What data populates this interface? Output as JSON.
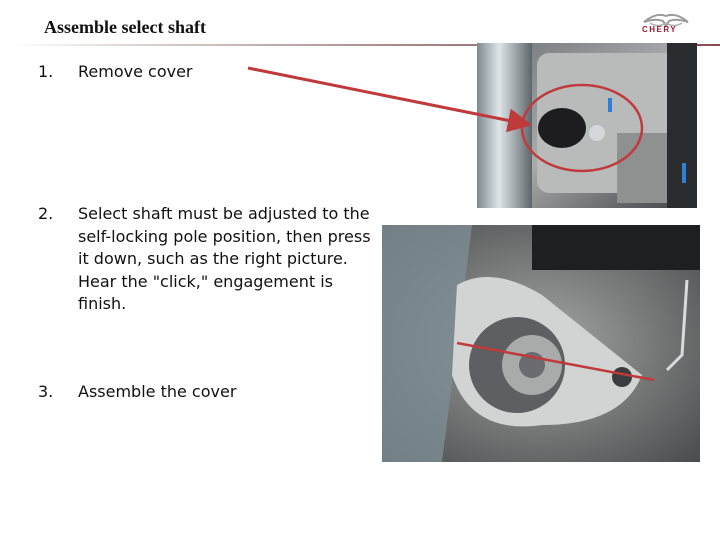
{
  "slide": {
    "title": "Assemble select shaft",
    "logo": {
      "brand": "CHERY",
      "icon": "chery-logo-icon"
    },
    "steps": [
      {
        "number": "1.",
        "text": "Remove cover"
      },
      {
        "number": "2.",
        "text": "Select shaft must be adjusted to the self-locking pole position, then press it down, such as the right picture. Hear the \"click,\" engagement is finish."
      },
      {
        "number": "3.",
        "text": "Assemble the cover"
      }
    ],
    "images": [
      {
        "name": "cover-removal-photo",
        "annotation": "red-circle-highlight"
      },
      {
        "name": "select-shaft-photo",
        "annotation": "red-line-indicator"
      }
    ],
    "colors": {
      "annotation_red": "#c0393b",
      "brand_red": "#9b1b30"
    }
  }
}
